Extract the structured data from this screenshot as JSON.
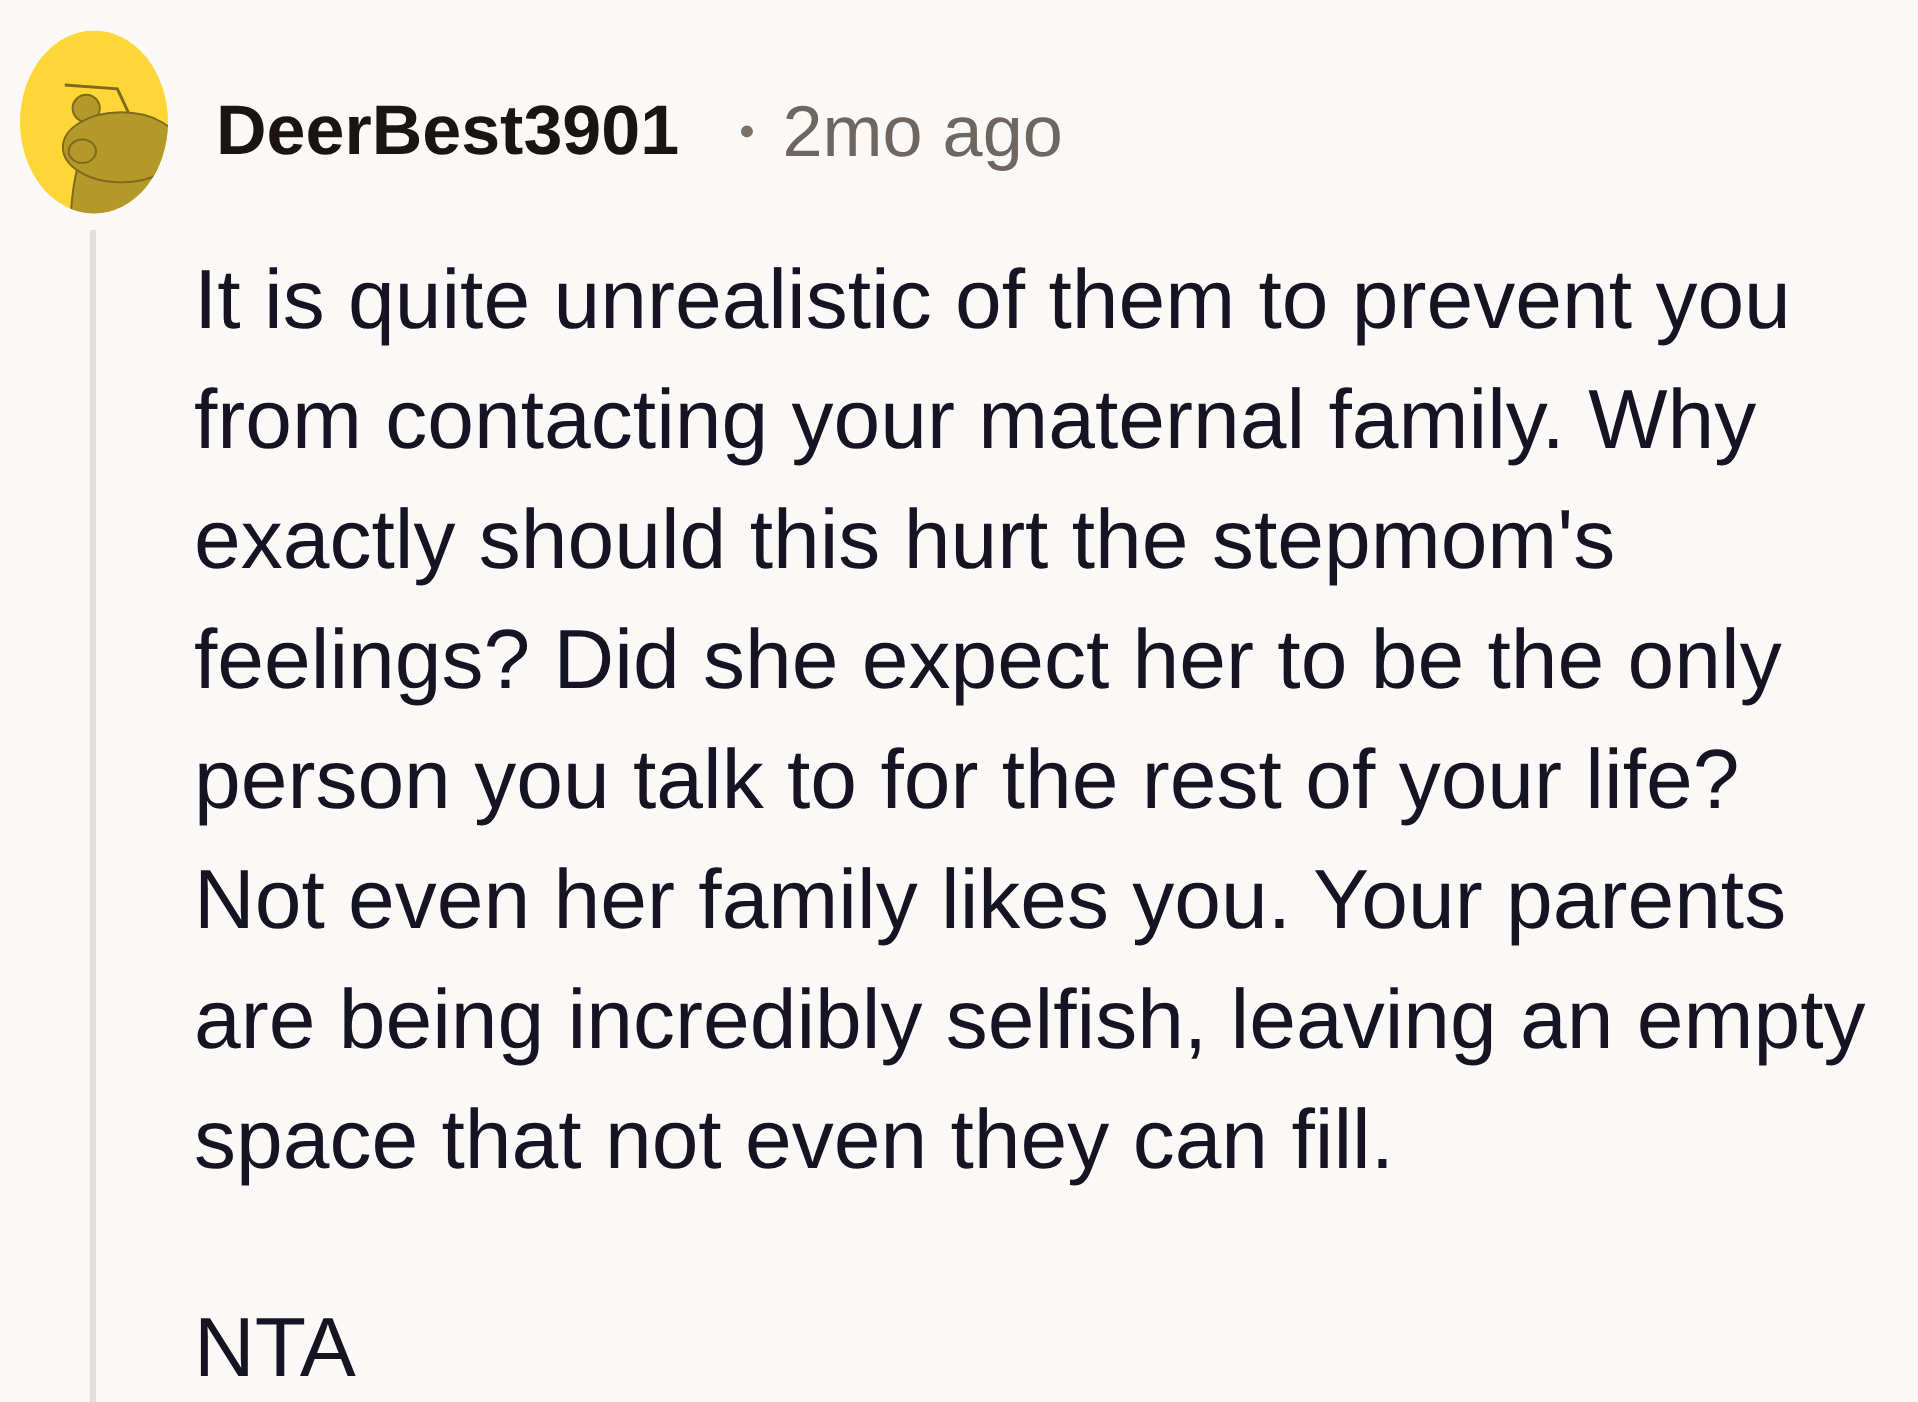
{
  "comment": {
    "author": "DeerBest3901",
    "separator": "•",
    "time": "2mo ago",
    "paragraphs": [
      "It is quite unrealistic of them to prevent you from contacting your maternal family. Why exactly should this hurt the stepmom's feelings? Did she expect her to be the only person you talk to for the rest of your life? Not even her family likes you. Your parents are being incredibly selfish, leaving an empty space that not even they can fill.",
      "NTA"
    ]
  }
}
